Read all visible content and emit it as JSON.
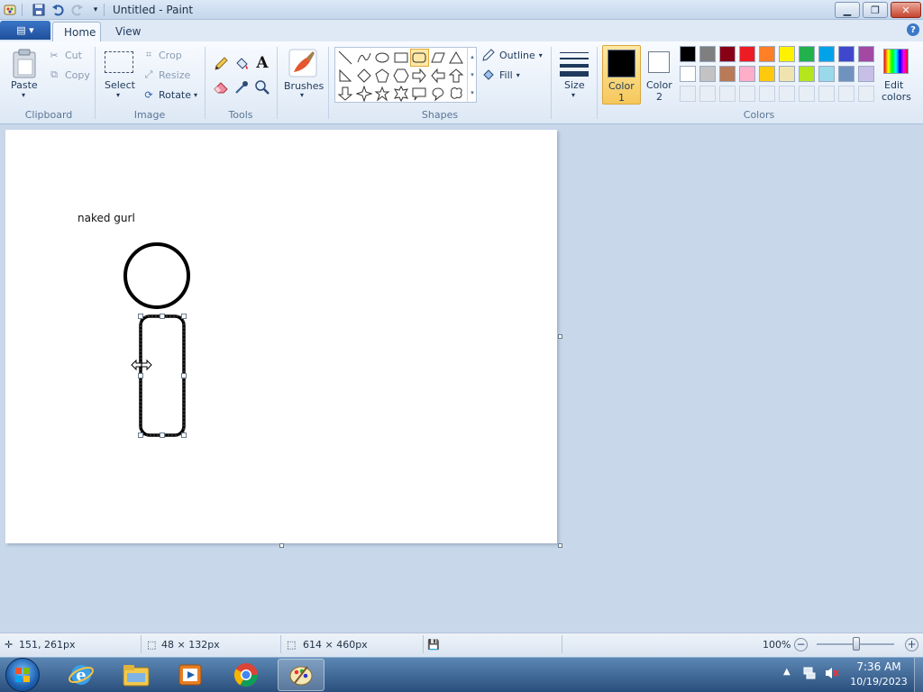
{
  "window": {
    "title": "Untitled - Paint"
  },
  "tabs": [
    {
      "label": "Home"
    },
    {
      "label": "View"
    }
  ],
  "clipboard": {
    "paste": "Paste",
    "cut": "Cut",
    "copy": "Copy",
    "group": "Clipboard"
  },
  "image": {
    "select": "Select",
    "crop": "Crop",
    "resize": "Resize",
    "rotate": "Rotate",
    "group": "Image"
  },
  "tools": {
    "group": "Tools"
  },
  "brushes": {
    "label": "Brushes"
  },
  "shapes": {
    "outline": "Outline",
    "fill": "Fill",
    "group": "Shapes"
  },
  "size": {
    "label": "Size"
  },
  "colors": {
    "color1_line1": "Color",
    "color1_line2": "1",
    "color2_line1": "Color",
    "color2_line2": "2",
    "edit_line1": "Edit",
    "edit_line2": "colors",
    "group": "Colors",
    "color1": "#000000",
    "color2": "#ffffff",
    "palette_row1": [
      "#000000",
      "#7f7f7f",
      "#880015",
      "#ed1c24",
      "#ff7f27",
      "#fff200",
      "#22b14c",
      "#00a2e8",
      "#3f48cc",
      "#a349a4"
    ],
    "palette_row2": [
      "#ffffff",
      "#c3c3c3",
      "#b97a57",
      "#ffaec9",
      "#ffc90e",
      "#efe4b0",
      "#b5e61d",
      "#99d9ea",
      "#7092be",
      "#c8bfe7"
    ]
  },
  "canvas": {
    "text": "naked gurl"
  },
  "status": {
    "cursor_pos": "151, 261px",
    "selection_size": "48 × 132px",
    "image_size": "614 × 460px",
    "zoom": "100%"
  },
  "tray": {
    "time": "7:36 AM",
    "date": "10/19/2023"
  },
  "icons": {
    "app": "paint-icon",
    "save": "save-icon",
    "undo": "undo-icon",
    "redo": "redo-icon",
    "cut": "scissors-icon",
    "copy": "copy-icon",
    "crop": "crop-icon",
    "resize": "resize-icon",
    "rotate": "rotate-icon",
    "pencil": "pencil-icon",
    "fill": "bucket-icon",
    "text": "text-icon",
    "eraser": "eraser-icon",
    "picker": "color-picker-icon",
    "magnifier": "magnifier-icon",
    "move_cursor": "move-cursor-icon"
  }
}
